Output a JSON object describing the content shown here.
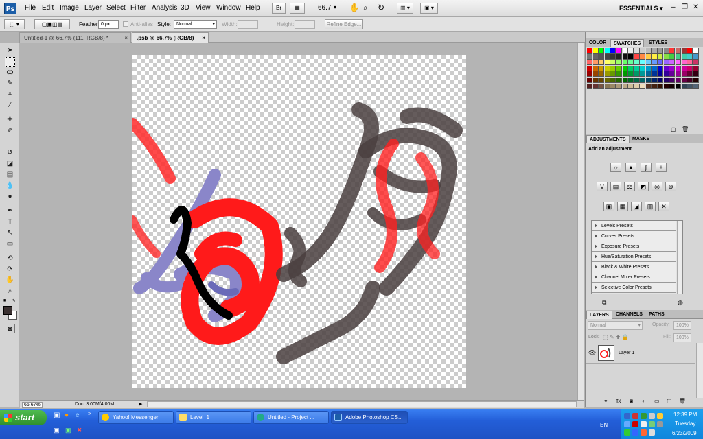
{
  "app": {
    "logo": "Ps",
    "zoom_display": "66.7",
    "workspace": "ESSENTIALS ▾"
  },
  "menu": [
    "File",
    "Edit",
    "Image",
    "Layer",
    "Select",
    "Filter",
    "Analysis",
    "3D",
    "View",
    "Window",
    "Help"
  ],
  "options": {
    "feather_label": "Feather:",
    "feather_value": "0 px",
    "antialias_label": "Anti-alias",
    "style_label": "Style:",
    "style_value": "Normal",
    "width_label": "Width:",
    "height_label": "Height:",
    "refine_label": "Refine Edge..."
  },
  "tabs": [
    {
      "label": "Untitled-1 @ 66.7% (111, RGB/8) *",
      "active": false
    },
    {
      "label": ".psb @ 66.7% (RGB/8)",
      "active": true
    }
  ],
  "status": {
    "zoom": "66.67%",
    "doc": "Doc: 3.00M/4.00M"
  },
  "panels": {
    "color_tabs": [
      "COLOR",
      "SWATCHES",
      "STYLES"
    ],
    "adjust_tabs": [
      "ADJUSTMENTS",
      "MASKS"
    ],
    "adjust_heading": "Add an adjustment",
    "presets": [
      "Levels Presets",
      "Curves Presets",
      "Exposure Presets",
      "Hue/Saturation Presets",
      "Black & White Presets",
      "Channel Mixer Presets",
      "Selective Color Presets"
    ],
    "layers_tabs": [
      "LAYERS",
      "CHANNELS",
      "PATHS"
    ],
    "blend_mode": "Normal",
    "opacity_label": "Opacity:",
    "opacity_value": "100%",
    "lock_label": "Lock:",
    "fill_label": "Fill:",
    "fill_value": "100%",
    "layer_name": "Layer 1"
  },
  "taskbar": {
    "start": "start",
    "buttons": [
      "Yahoo! Messenger",
      "Level_1",
      "Untitled      - Project ...",
      "Adobe Photoshop CS..."
    ],
    "lang": "EN",
    "time": "12:39 PM",
    "day": "Tuesday",
    "date": "6/23/2009"
  },
  "colors": {
    "brand": "#1c5ea8",
    "taskbar": "#235ed8",
    "foreground_swatch": "#3a3030",
    "background_swatch": "#ffffff"
  }
}
